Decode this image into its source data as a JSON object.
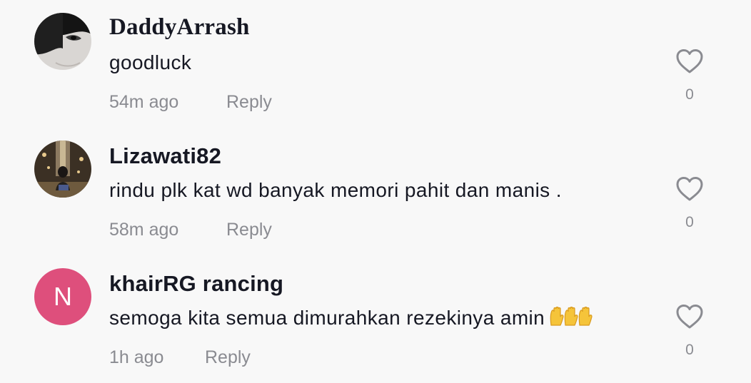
{
  "comments": [
    {
      "username": "DaddyArrash",
      "text": "goodluck",
      "time": "54m ago",
      "reply": "Reply",
      "likes": "0",
      "avatar": "photo"
    },
    {
      "username": "Lizawati82",
      "text": "rindu plk kat wd banyak memori pahit dan manis .",
      "time": "58m ago",
      "reply": "Reply",
      "likes": "0",
      "avatar": "photo"
    },
    {
      "username": "khairRG rancing",
      "text": "semoga kita semua dimurahkan rezekinya amin",
      "time": "1h ago",
      "reply": "Reply",
      "likes": "0",
      "avatar_initial": "N",
      "avatar_color": "#de4f7c",
      "emoji": "raised-hands-emoji x3"
    }
  ]
}
